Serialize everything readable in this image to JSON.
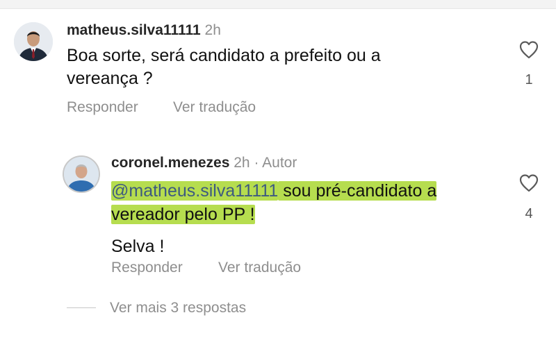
{
  "comment": {
    "username": "matheus.silva11111",
    "time": "2h",
    "text_line1": "Boa sorte, será candidato a prefeito ou a",
    "text_line2": "vereança ?",
    "likes": "1",
    "reply_label": "Responder",
    "translate_label": "Ver tradução"
  },
  "reply": {
    "username": "coronel.menezes",
    "time": "2h",
    "separator": "·",
    "author_badge": "Autor",
    "mention": "@matheus.silva11111",
    "text_part1": " sou pré-candidato a",
    "text_line2": "vereador pelo PP !",
    "text_line3": "Selva !",
    "likes": "4",
    "reply_label": "Responder",
    "translate_label": "Ver tradução"
  },
  "view_more": {
    "label": "Ver mais 3 respostas"
  },
  "colors": {
    "highlight": "#b6dd4f",
    "muted": "#8e8e8e",
    "mention": "#3d5a80"
  }
}
